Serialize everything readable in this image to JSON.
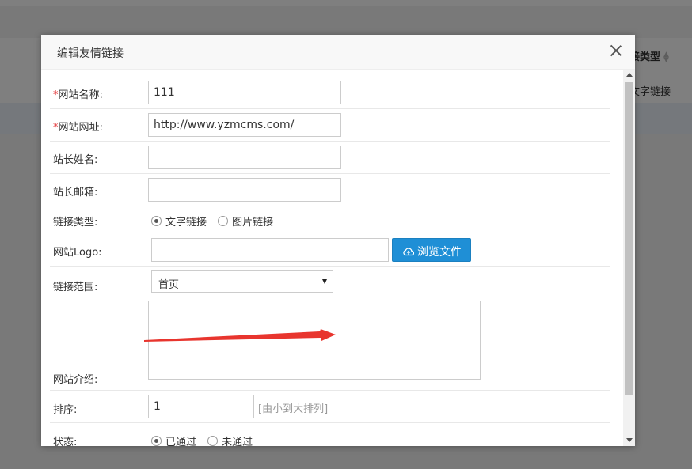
{
  "background": {
    "column_header": "接类型",
    "column_cell": "文字链接"
  },
  "modal": {
    "title": "编辑友情链接",
    "close_icon": "close-icon"
  },
  "form": {
    "site_name": {
      "required_mark": "*",
      "label": "网站名称:",
      "value": "111"
    },
    "site_url": {
      "required_mark": "*",
      "label": "网站网址:",
      "value": "http://www.yzmcms.com/"
    },
    "owner_name": {
      "label": "站长姓名:",
      "value": ""
    },
    "owner_email": {
      "label": "站长邮箱:",
      "value": ""
    },
    "link_type": {
      "label": "链接类型:",
      "options": [
        "文字链接",
        "图片链接"
      ],
      "selected": "文字链接"
    },
    "logo": {
      "label": "网站Logo:",
      "value": "",
      "browse_label": "浏览文件",
      "browse_icon": "cloud-upload-icon"
    },
    "link_scope": {
      "label": "链接范围:",
      "selected": "首页"
    },
    "intro": {
      "label": "网站介绍:",
      "value": ""
    },
    "sort": {
      "label": "排序:",
      "value": "1",
      "hint": "[由小到大排列]"
    },
    "status": {
      "label": "状态:",
      "options": [
        "已通过",
        "未通过"
      ],
      "selected": "已通过"
    }
  },
  "colors": {
    "primary_button": "#1f8fd6",
    "required": "#e4393c",
    "annotation_arrow": "#e8352e"
  }
}
